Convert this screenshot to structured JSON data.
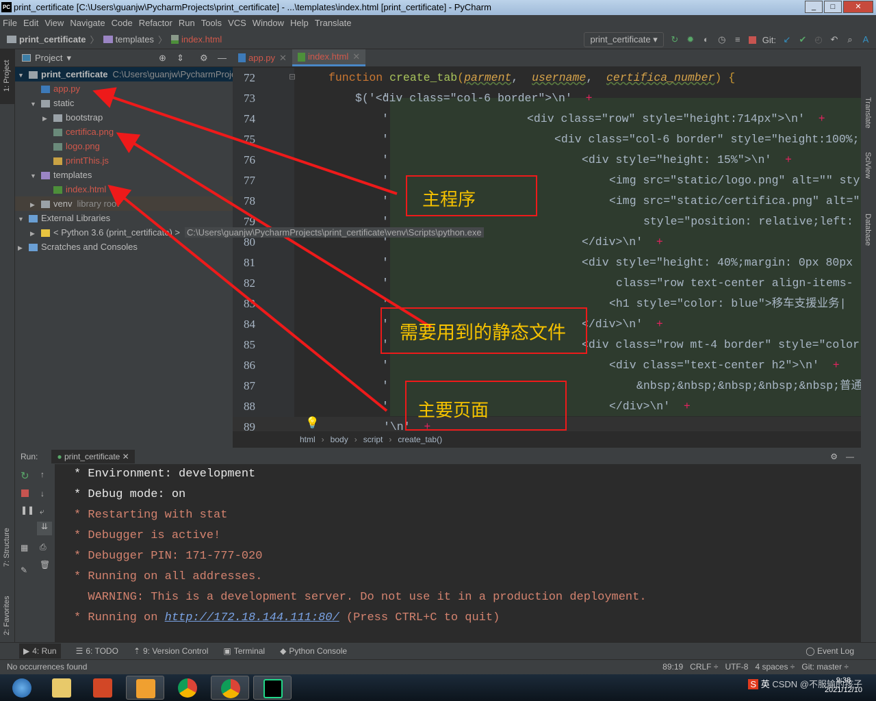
{
  "window": {
    "title": "print_certificate [C:\\Users\\guanjw\\PycharmProjects\\print_certificate] - ...\\templates\\index.html [print_certificate] - PyCharm",
    "logo": "PC"
  },
  "menu": [
    "File",
    "Edit",
    "View",
    "Navigate",
    "Code",
    "Refactor",
    "Run",
    "Tools",
    "VCS",
    "Window",
    "Help",
    "Translate"
  ],
  "breadcrumb": {
    "project": "print_certificate",
    "folder": "templates",
    "file": "index.html"
  },
  "toolbar": {
    "run_config": "print_certificate",
    "git_label": "Git:"
  },
  "project_panel": {
    "title": "Project",
    "tree": [
      {
        "label": "print_certificate",
        "extra": "C:\\Users\\guanjw\\PycharmProje",
        "depth": 0,
        "expand": "open",
        "kind": "root"
      },
      {
        "label": "app.py",
        "depth": 1,
        "kind": "py"
      },
      {
        "label": "static",
        "depth": 1,
        "expand": "open",
        "kind": "folder"
      },
      {
        "label": "bootstrap",
        "depth": 2,
        "expand": "closed",
        "kind": "folder"
      },
      {
        "label": "certifica.png",
        "depth": 2,
        "kind": "img"
      },
      {
        "label": "logo.png",
        "depth": 2,
        "kind": "img"
      },
      {
        "label": "printThis.js",
        "depth": 2,
        "kind": "js"
      },
      {
        "label": "templates",
        "depth": 1,
        "expand": "open",
        "kind": "tfolder"
      },
      {
        "label": "index.html",
        "depth": 2,
        "kind": "html"
      },
      {
        "label": "venv",
        "extra": "library root",
        "depth": 1,
        "expand": "closed",
        "kind": "folder"
      },
      {
        "label": "External Libraries",
        "depth": 0,
        "expand": "open",
        "kind": "lib"
      },
      {
        "label": "< Python 3.6 (print_certificate) >",
        "extra": "C:\\Users\\guanjw\\PycharmProjects\\print_certificate\\venv\\Scripts\\python.exe",
        "depth": 1,
        "expand": "closed",
        "kind": "python"
      },
      {
        "label": "Scratches and Consoles",
        "depth": 0,
        "expand": "closed",
        "kind": "scratch"
      }
    ]
  },
  "side_tabs": {
    "left_top": "1: Project",
    "structure": "7: Structure",
    "favorites": "2: Favorites",
    "right": [
      "Translate",
      "SciView",
      "Database"
    ]
  },
  "editor": {
    "tabs": [
      {
        "label": "app.py",
        "active": false
      },
      {
        "label": "index.html",
        "active": true
      }
    ],
    "lines": [
      {
        "n": "72",
        "ind": 140,
        "tok": [
          [
            "kw",
            "function "
          ],
          [
            "fn",
            "create_tab"
          ],
          [
            "punc",
            "("
          ],
          [
            "param",
            "parment"
          ],
          [
            "txt",
            ",  "
          ],
          [
            "param",
            "username"
          ],
          [
            "txt",
            ",  "
          ],
          [
            "param",
            "certifica_number"
          ],
          [
            "punc",
            ") {"
          ]
        ]
      },
      {
        "n": "73",
        "ind": 179,
        "tok": [
          [
            "txt",
            "$('"
          ],
          [
            "str",
            "<div class=\"col-6 border\">\\n'"
          ],
          [
            "plus",
            "  +"
          ]
        ]
      },
      {
        "n": "74",
        "ind": 430,
        "tok": [
          [
            "str",
            "<div class=\"row\" style=\"height:714px\">\\n'"
          ],
          [
            "plus",
            "  +"
          ]
        ]
      },
      {
        "n": "75",
        "ind": 470,
        "tok": [
          [
            "str",
            "<div class=\"col-6 border\" style=\"height:100%;"
          ]
        ]
      },
      {
        "n": "76",
        "ind": 510,
        "tok": [
          [
            "str",
            "<div style=\"height: 15%\">\\n'"
          ],
          [
            "plus",
            "  +"
          ]
        ]
      },
      {
        "n": "77",
        "ind": 550,
        "tok": [
          [
            "str",
            "<img src=\"static/logo.png\" alt=\"\" sty"
          ]
        ]
      },
      {
        "n": "78",
        "ind": 550,
        "tok": [
          [
            "str",
            "<img src=\"static/certifica.png\" alt=\""
          ]
        ]
      },
      {
        "n": "79",
        "ind": 600,
        "tok": [
          [
            "str",
            "style=\"position: relative;left:"
          ]
        ]
      },
      {
        "n": "80",
        "ind": 510,
        "tok": [
          [
            "str",
            "</div>\\n'"
          ],
          [
            "plus",
            "  +"
          ]
        ]
      },
      {
        "n": "81",
        "ind": 510,
        "tok": [
          [
            "str",
            "<div style=\"height: 40%;margin: 0px 80px"
          ]
        ]
      },
      {
        "n": "82",
        "ind": 560,
        "tok": [
          [
            "str",
            "class=\"row text-center align-items-"
          ]
        ]
      },
      {
        "n": "83",
        "ind": 550,
        "tok": [
          [
            "str",
            "<h1 style=\"color: blue\">移车支援业务|"
          ]
        ]
      },
      {
        "n": "84",
        "ind": 510,
        "tok": [
          [
            "str",
            "</div>\\n'"
          ],
          [
            "plus",
            "  +"
          ]
        ]
      },
      {
        "n": "85",
        "ind": 510,
        "tok": [
          [
            "str",
            "<div class=\"row mt-4 border\" style=\"color"
          ]
        ]
      },
      {
        "n": "86",
        "ind": 550,
        "tok": [
          [
            "str",
            "<div class=\"text-center h2\">\\n'"
          ],
          [
            "plus",
            "  +"
          ]
        ]
      },
      {
        "n": "87",
        "ind": 590,
        "tok": [
          [
            "str",
            "&nbsp;&nbsp;&nbsp;&nbsp;&nbsp;普通"
          ]
        ]
      },
      {
        "n": "88",
        "ind": 550,
        "tok": [
          [
            "str",
            "</div>\\n'"
          ],
          [
            "plus",
            "  +"
          ]
        ]
      },
      {
        "n": "89",
        "ind": 220,
        "tok": [
          [
            "str",
            "'\\n'"
          ],
          [
            "plus",
            "  +"
          ]
        ]
      }
    ],
    "quote_mark": "'",
    "crumbs": [
      "html",
      "body",
      "script",
      "create_tab()"
    ]
  },
  "run_panel": {
    "label": "Run:",
    "tab": "print_certificate",
    "output": [
      {
        "t": "* Environment: development",
        "s": "w"
      },
      {
        "t": "* Debug mode: on",
        "s": "w"
      },
      {
        "t": "* Restarting with stat",
        "s": "r"
      },
      {
        "t": "* Debugger is active!",
        "s": "r"
      },
      {
        "t": "* Debugger PIN: 171-777-020",
        "s": "r"
      },
      {
        "t": "* Running on all addresses.",
        "s": "r"
      },
      {
        "t": "  WARNING: This is a development server. Do not use it in a production deployment.",
        "s": "r"
      }
    ],
    "last_line": {
      "prefix": "* Running on ",
      "link": "http://172.18.144.111:80/",
      "suffix": " (Press CTRL+C to quit)"
    }
  },
  "bottom_tabs": [
    "4: Run",
    "6: TODO",
    "9: Version Control",
    "Terminal",
    "Python Console"
  ],
  "event_log": "Event Log",
  "status": {
    "message": "No occurrences found",
    "position": "89:19",
    "line_sep": "CRLF ÷",
    "encoding": "UTF-8",
    "indent": "4 spaces ÷",
    "git": "Git: master ÷"
  },
  "tray": {
    "text": "英  ",
    "watermark": "CSDN @不服输的孩子",
    "time": "9:38",
    "date": "2021/12/10"
  },
  "annotations": [
    "主程序",
    "需要用到的静态文件",
    "主要页面"
  ],
  "colors": {
    "annotation_border": "#ee1a1a",
    "annotation_text": "#f6c200",
    "modified_file": "#d1584b"
  }
}
